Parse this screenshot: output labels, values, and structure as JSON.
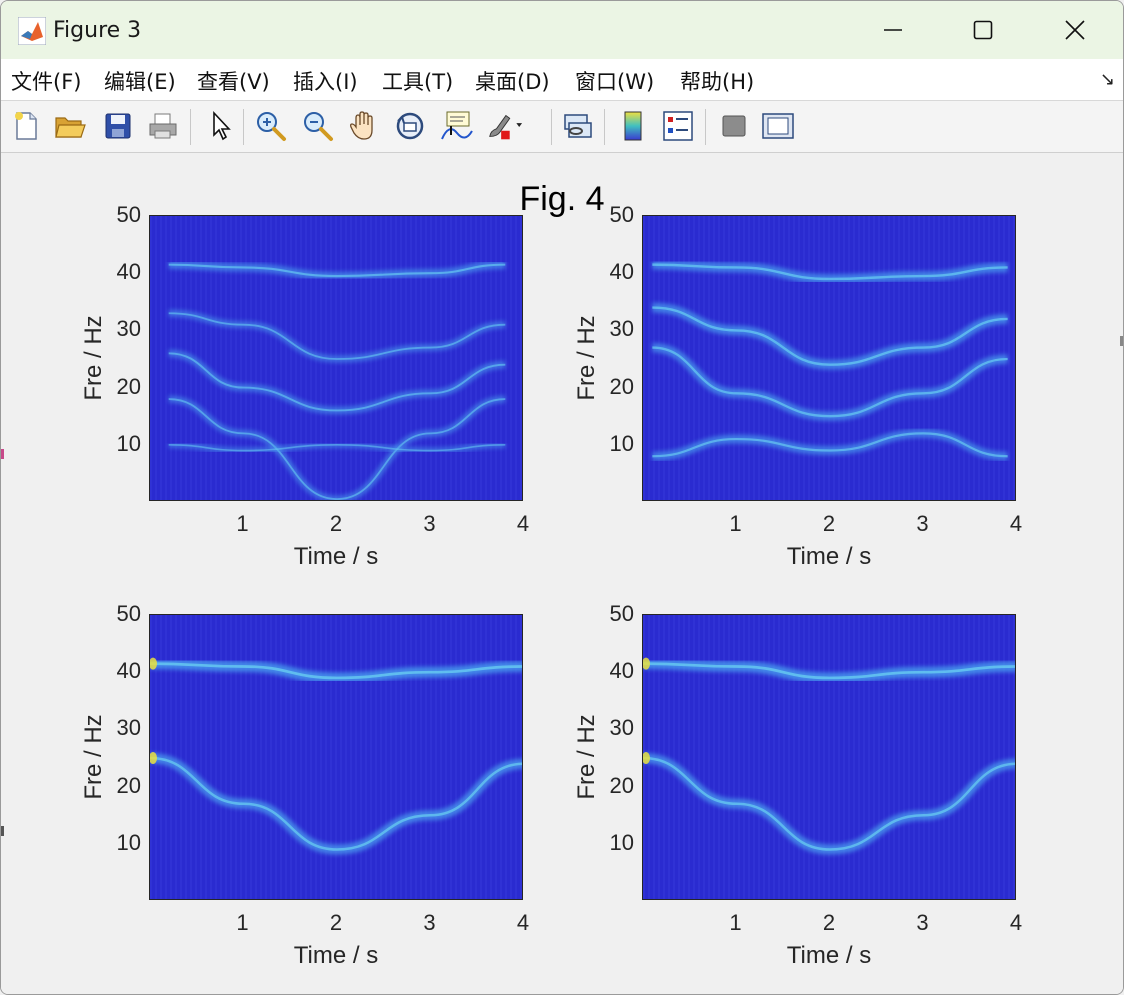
{
  "window": {
    "title": "Figure 3",
    "controls": [
      "minimize",
      "maximize",
      "close"
    ]
  },
  "menu": {
    "items": [
      "文件(F)",
      "编辑(E)",
      "查看(V)",
      "插入(I)",
      "工具(T)",
      "桌面(D)",
      "窗口(W)",
      "帮助(H)"
    ]
  },
  "toolbar": {
    "icons": [
      "new-figure-icon",
      "open-file-icon",
      "save-icon",
      "print-icon",
      "select-arrow-icon",
      "zoom-in-icon",
      "zoom-out-icon",
      "pan-hand-icon",
      "rotate-3d-icon",
      "data-cursor-icon",
      "brush-icon",
      "link-plot-icon",
      "colorbar-icon",
      "legend-icon",
      "hide-plot-tools-icon",
      "show-plot-tools-icon"
    ]
  },
  "figure": {
    "suptitle": "Fig. 4",
    "colormap": "parula",
    "colors": {
      "background": "#2a2bd0",
      "ridge": "#4aa0f0",
      "peak": "#e8e040"
    },
    "axes": [
      {
        "xlabel": "Time / s",
        "ylabel": "Fre / Hz",
        "xticks": [
          "1",
          "2",
          "3",
          "4"
        ],
        "yticks": [
          "50",
          "40",
          "30",
          "20",
          "10"
        ],
        "xlim": [
          0,
          4
        ],
        "ylim": [
          0,
          50
        ],
        "ridges": [
          {
            "points": [
              [
                0.2,
                41.5
              ],
              [
                1.0,
                41
              ],
              [
                2.0,
                39.5
              ],
              [
                3.0,
                40
              ],
              [
                3.8,
                41.5
              ]
            ],
            "intensity": 0.55
          },
          {
            "points": [
              [
                0.2,
                33
              ],
              [
                1.0,
                31
              ],
              [
                2.0,
                25
              ],
              [
                3.0,
                27
              ],
              [
                3.8,
                31
              ]
            ],
            "intensity": 0.4
          },
          {
            "points": [
              [
                0.2,
                26
              ],
              [
                1.0,
                20
              ],
              [
                2.0,
                16
              ],
              [
                3.0,
                19
              ],
              [
                3.8,
                24
              ]
            ],
            "intensity": 0.45
          },
          {
            "points": [
              [
                0.2,
                18
              ],
              [
                1.0,
                12
              ],
              [
                2.0,
                0.5
              ],
              [
                3.0,
                12
              ],
              [
                3.8,
                18
              ]
            ],
            "intensity": 0.4
          },
          {
            "points": [
              [
                0.2,
                10
              ],
              [
                1.0,
                9
              ],
              [
                2.0,
                10
              ],
              [
                3.0,
                9
              ],
              [
                3.8,
                10
              ]
            ],
            "intensity": 0.3
          }
        ]
      },
      {
        "xlabel": "Time / s",
        "ylabel": "Fre / Hz",
        "xticks": [
          "1",
          "2",
          "3",
          "4"
        ],
        "yticks": [
          "50",
          "40",
          "30",
          "20",
          "10"
        ],
        "xlim": [
          0,
          4
        ],
        "ylim": [
          0,
          50
        ],
        "ridges": [
          {
            "points": [
              [
                0.1,
                41.5
              ],
              [
                1.0,
                41
              ],
              [
                2.0,
                39
              ],
              [
                3.0,
                39.5
              ],
              [
                3.9,
                41
              ]
            ],
            "intensity": 0.7
          },
          {
            "points": [
              [
                0.1,
                34
              ],
              [
                1.0,
                30
              ],
              [
                2.0,
                24
              ],
              [
                3.0,
                27
              ],
              [
                3.9,
                32
              ]
            ],
            "intensity": 0.7
          },
          {
            "points": [
              [
                0.1,
                27
              ],
              [
                1.0,
                19
              ],
              [
                2.0,
                15
              ],
              [
                3.0,
                19
              ],
              [
                3.9,
                25
              ]
            ],
            "intensity": 0.65
          },
          {
            "points": [
              [
                0.1,
                8
              ],
              [
                1.0,
                11
              ],
              [
                2.0,
                9
              ],
              [
                3.0,
                12
              ],
              [
                3.9,
                8
              ]
            ],
            "intensity": 0.6
          }
        ]
      },
      {
        "xlabel": "Time / s",
        "ylabel": "Fre / Hz",
        "xticks": [
          "1",
          "2",
          "3",
          "4"
        ],
        "yticks": [
          "50",
          "40",
          "30",
          "20",
          "10"
        ],
        "xlim": [
          0,
          4
        ],
        "ylim": [
          0,
          50
        ],
        "ridges": [
          {
            "points": [
              [
                0.0,
                41.5
              ],
              [
                1.0,
                41
              ],
              [
                2.0,
                39
              ],
              [
                3.0,
                40
              ],
              [
                4.0,
                41
              ]
            ],
            "intensity": 0.85
          },
          {
            "points": [
              [
                0.0,
                25
              ],
              [
                1.0,
                17
              ],
              [
                2.0,
                9
              ],
              [
                3.0,
                15
              ],
              [
                4.0,
                24
              ]
            ],
            "intensity": 0.75
          }
        ]
      },
      {
        "xlabel": "Time / s",
        "ylabel": "Fre / Hz",
        "xticks": [
          "1",
          "2",
          "3",
          "4"
        ],
        "yticks": [
          "50",
          "40",
          "30",
          "20",
          "10"
        ],
        "xlim": [
          0,
          4
        ],
        "ylim": [
          0,
          50
        ],
        "ridges": [
          {
            "points": [
              [
                0.0,
                41.5
              ],
              [
                1.0,
                41
              ],
              [
                2.0,
                39
              ],
              [
                3.0,
                40
              ],
              [
                4.0,
                41
              ]
            ],
            "intensity": 0.85
          },
          {
            "points": [
              [
                0.0,
                25
              ],
              [
                1.0,
                17
              ],
              [
                2.0,
                9
              ],
              [
                3.0,
                15
              ],
              [
                4.0,
                24
              ]
            ],
            "intensity": 0.75
          }
        ]
      }
    ]
  }
}
